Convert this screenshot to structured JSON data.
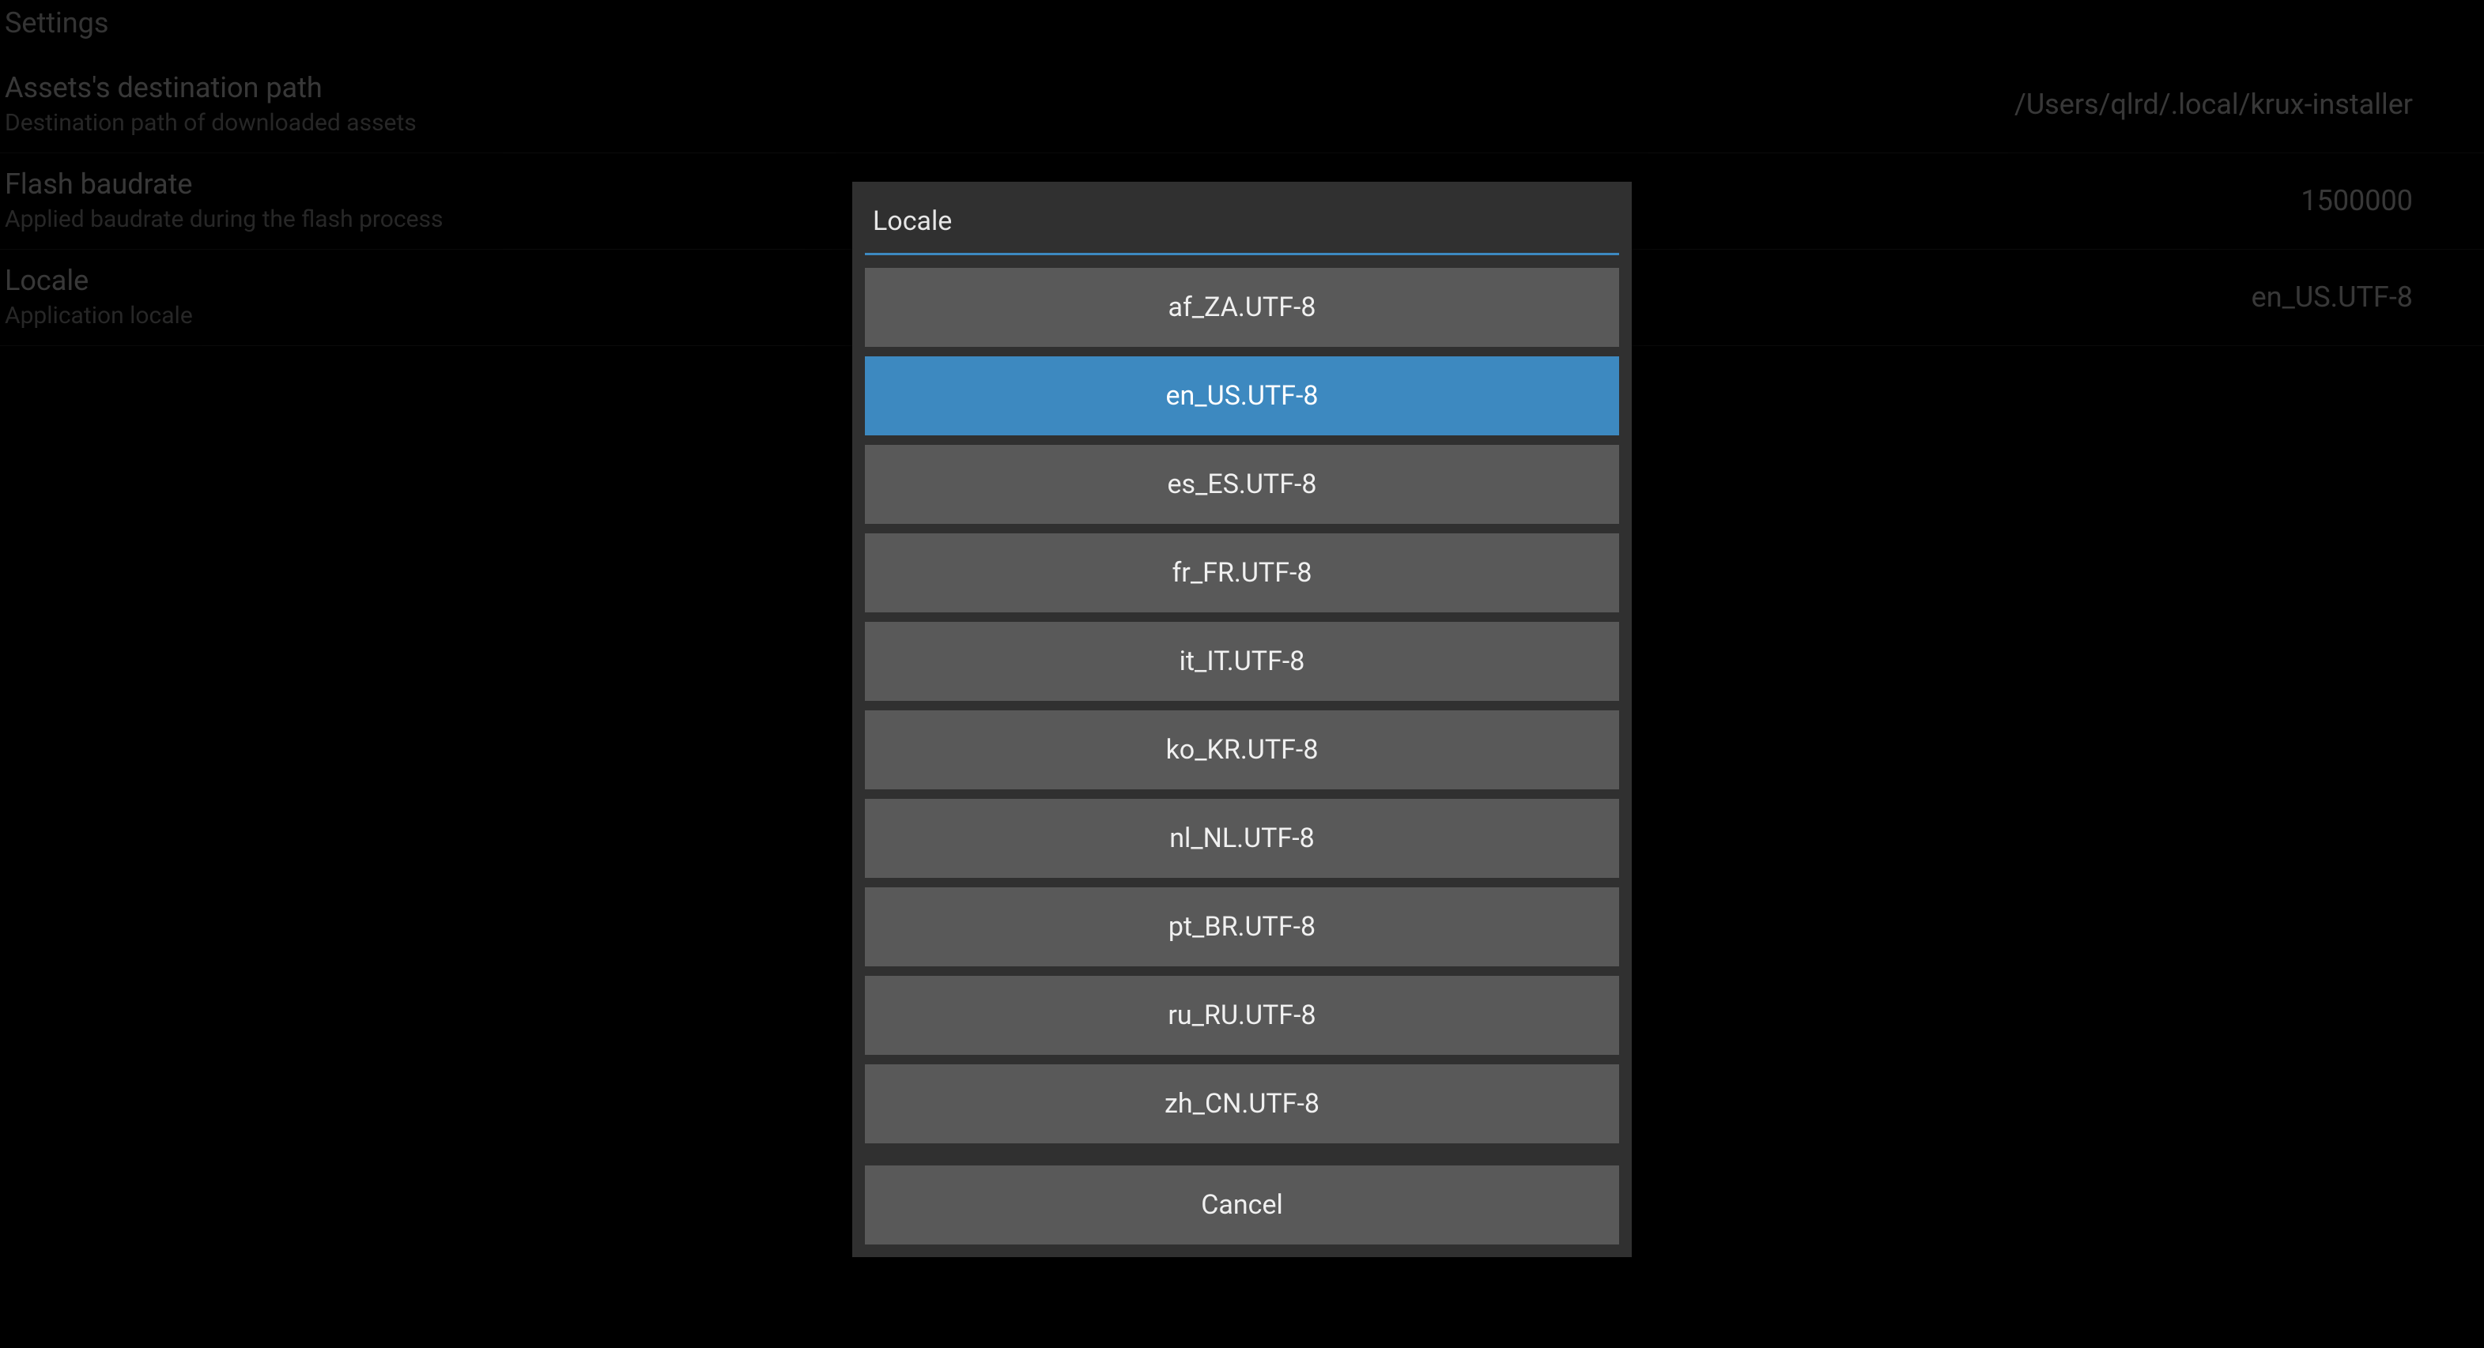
{
  "settings": {
    "header": "Settings",
    "rows": [
      {
        "title": "Assets's destination path",
        "subtitle": "Destination path of downloaded assets",
        "value": "/Users/qlrd/.local/krux-installer"
      },
      {
        "title": "Flash baudrate",
        "subtitle": "Applied baudrate during the flash process",
        "value": "1500000"
      },
      {
        "title": "Locale",
        "subtitle": "Application locale",
        "value": "en_US.UTF-8"
      }
    ]
  },
  "modal": {
    "title": "Locale",
    "selected": "en_US.UTF-8",
    "options": [
      "af_ZA.UTF-8",
      "en_US.UTF-8",
      "es_ES.UTF-8",
      "fr_FR.UTF-8",
      "it_IT.UTF-8",
      "ko_KR.UTF-8",
      "nl_NL.UTF-8",
      "pt_BR.UTF-8",
      "ru_RU.UTF-8",
      "zh_CN.UTF-8"
    ],
    "cancel_label": "Cancel"
  }
}
